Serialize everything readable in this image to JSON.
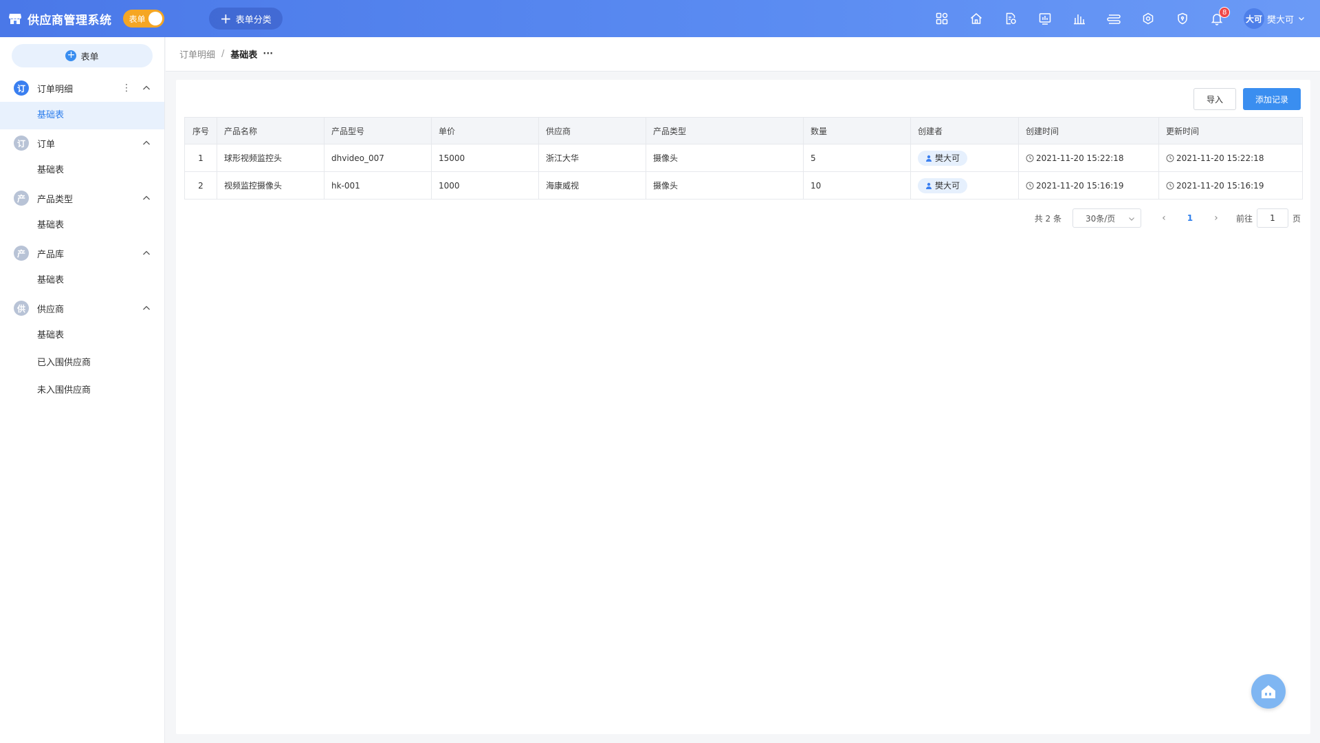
{
  "header": {
    "app_title": "供应商管理系统",
    "mode_toggle_label": "表单",
    "category_button_label": "表单分类",
    "notification_count": "8",
    "user_avatar_text": "大可",
    "user_name": "樊大可"
  },
  "sidebar": {
    "new_form_label": "表单",
    "groups": [
      {
        "icon_text": "订",
        "label": "订单明细",
        "active": true,
        "items": [
          {
            "label": "基础表",
            "active": true
          }
        ]
      },
      {
        "icon_text": "订",
        "label": "订单",
        "items": [
          {
            "label": "基础表"
          }
        ]
      },
      {
        "icon_text": "产",
        "label": "产品类型",
        "items": [
          {
            "label": "基础表"
          }
        ]
      },
      {
        "icon_text": "产",
        "label": "产品库",
        "items": [
          {
            "label": "基础表"
          }
        ]
      },
      {
        "icon_text": "供",
        "label": "供应商",
        "items": [
          {
            "label": "基础表"
          },
          {
            "label": "已入围供应商"
          },
          {
            "label": "未入围供应商"
          }
        ]
      }
    ]
  },
  "breadcrumb": {
    "parent": "订单明细",
    "separator": "/",
    "current": "基础表",
    "more": "···"
  },
  "toolbar": {
    "import_label": "导入",
    "add_label": "添加记录"
  },
  "table": {
    "columns": [
      "序号",
      "产品名称",
      "产品型号",
      "单价",
      "供应商",
      "产品类型",
      "数量",
      "创建者",
      "创建时间",
      "更新时间"
    ],
    "rows": [
      {
        "index": "1",
        "product_name": "球形视频监控头",
        "model": "dhvideo_007",
        "price": "15000",
        "supplier": "浙江大华",
        "type": "摄像头",
        "qty": "5",
        "creator": "樊大可",
        "created": "2021-11-20 15:22:18",
        "updated": "2021-11-20 15:22:18"
      },
      {
        "index": "2",
        "product_name": "视频监控摄像头",
        "model": "hk-001",
        "price": "1000",
        "supplier": "海康威视",
        "type": "摄像头",
        "qty": "10",
        "creator": "樊大可",
        "created": "2021-11-20 15:16:19",
        "updated": "2021-11-20 15:16:19"
      }
    ]
  },
  "pagination": {
    "total": "共 2 条",
    "page_size": "30条/页",
    "current_page": "1",
    "goto_label": "前往",
    "goto_value": "1",
    "page_suffix": "页"
  },
  "colors": {
    "header_start": "#4a78e8",
    "accent": "#3a8ef0",
    "toggle": "#f5a623",
    "badge": "#f04848"
  },
  "icons": [
    "store-icon",
    "apps-icon",
    "home-icon",
    "file-settings-icon",
    "dashboard-icon",
    "bar-chart-icon",
    "server-icon",
    "network-icon",
    "shield-icon",
    "bell-icon",
    "clock-icon",
    "user-icon",
    "chevron-up-icon",
    "chevron-down-icon",
    "home-float-icon"
  ]
}
